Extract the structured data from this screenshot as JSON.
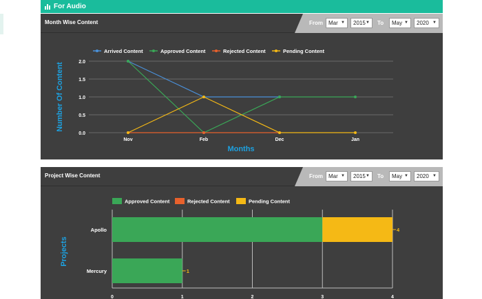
{
  "topbar": {
    "title": "For Audio"
  },
  "filters": {
    "from_label": "From",
    "to_label": "To",
    "from_month": "Mar",
    "from_year": "2015",
    "to_month": "May",
    "to_year": "2020"
  },
  "month_panel": {
    "title": "Month Wise Content",
    "chart_data": {
      "type": "line",
      "x": [
        "Nov",
        "Feb",
        "Dec",
        "Jan"
      ],
      "xlabel": "Months",
      "ylabel": "Number Of Content",
      "ylim": [
        0,
        2
      ],
      "yticks": [
        "0.0",
        "0.5",
        "1.0",
        "1.5",
        "2.0"
      ],
      "grid": true,
      "legend_position": "top",
      "series": [
        {
          "name": "Arrived Content",
          "color": "#4a90d9",
          "values": [
            2,
            1,
            1,
            null
          ]
        },
        {
          "name": "Approved Content",
          "color": "#3aa757",
          "values": [
            2,
            0,
            1,
            1
          ]
        },
        {
          "name": "Rejected Content",
          "color": "#e8612c",
          "values": [
            0,
            0,
            0,
            null
          ]
        },
        {
          "name": "Pending Content",
          "color": "#f5b915",
          "values": [
            0,
            1,
            0,
            0
          ]
        }
      ]
    }
  },
  "project_panel": {
    "title": "Project Wise Content",
    "chart_data": {
      "type": "bar",
      "orientation": "horizontal",
      "stacked": true,
      "categories": [
        "Apollo",
        "Mercury"
      ],
      "ylabel": "Projects",
      "xlim": [
        0,
        4
      ],
      "xticks": [
        "0",
        "1",
        "2",
        "3",
        "4"
      ],
      "legend_position": "top",
      "series": [
        {
          "name": "Approved Content",
          "color": "#3aa757",
          "values": [
            3,
            1
          ]
        },
        {
          "name": "Rejected Content",
          "color": "#e8612c",
          "values": [
            0,
            0
          ]
        },
        {
          "name": "Pending Content",
          "color": "#f5b915",
          "values": [
            1,
            0
          ]
        }
      ],
      "total_labels": [
        "4",
        "1"
      ]
    }
  }
}
